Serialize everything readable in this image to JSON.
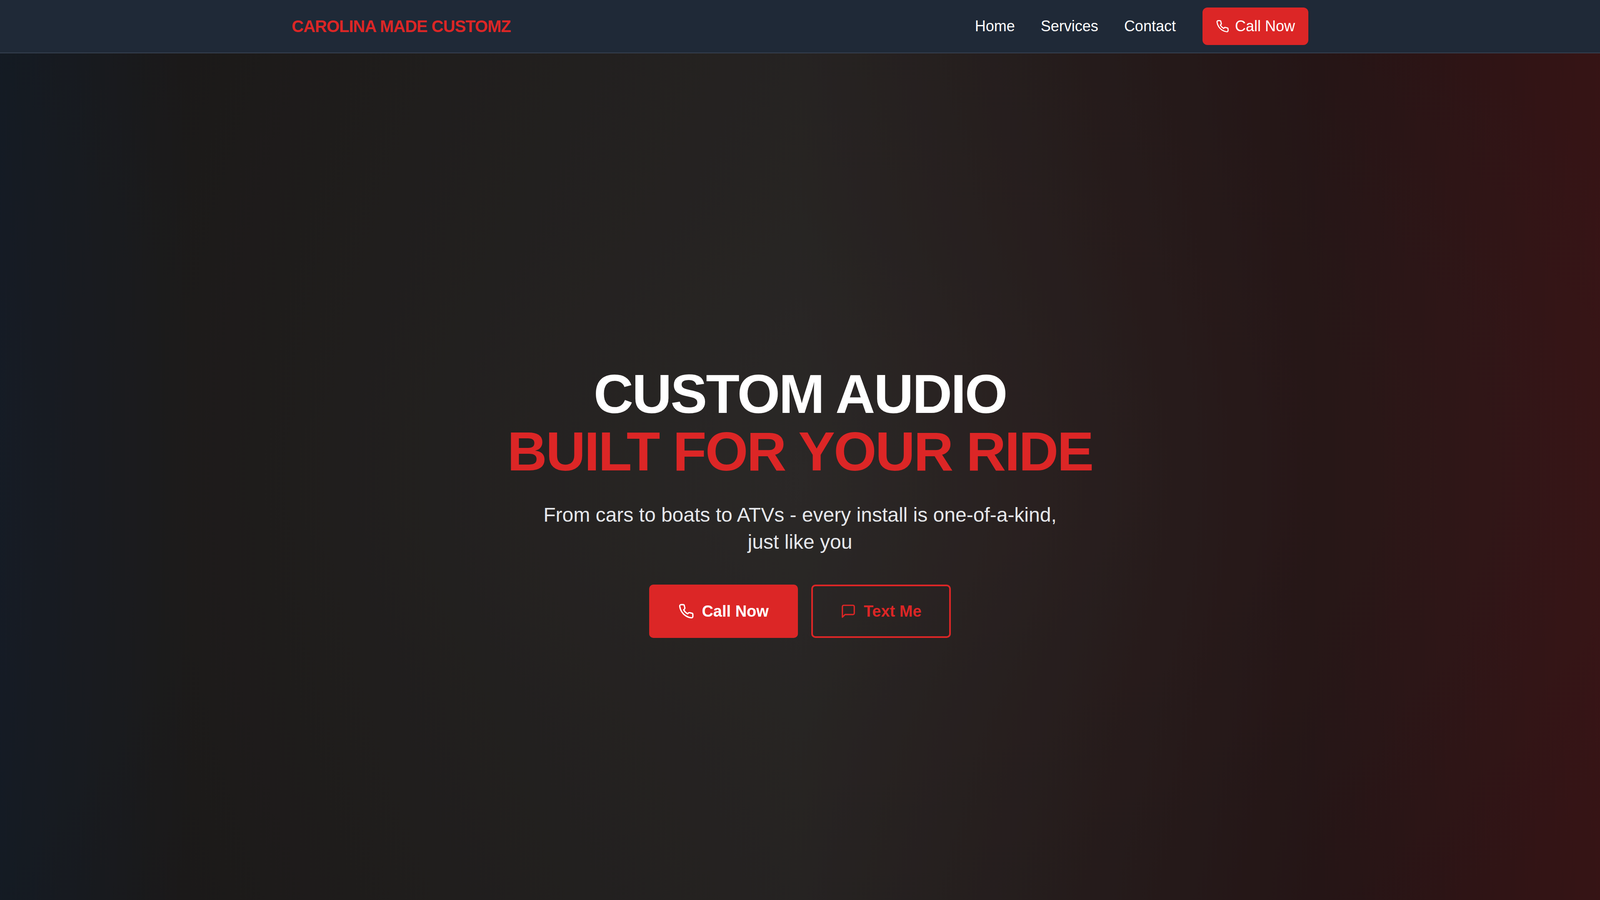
{
  "nav": {
    "logo": "CAROLINA MADE CUSTOMZ",
    "links": [
      "Home",
      "Services",
      "Contact"
    ],
    "cta": "Call Now"
  },
  "hero": {
    "title_line1": "CUSTOM AUDIO",
    "title_line2": "BUILT FOR YOUR RIDE",
    "subtitle": "From cars to boats to ATVs - every install is one-of-a-kind, just like you",
    "buttons": [
      {
        "label": "Call Now",
        "kind": "primary"
      },
      {
        "label": "Text Me",
        "kind": "outline"
      }
    ]
  }
}
